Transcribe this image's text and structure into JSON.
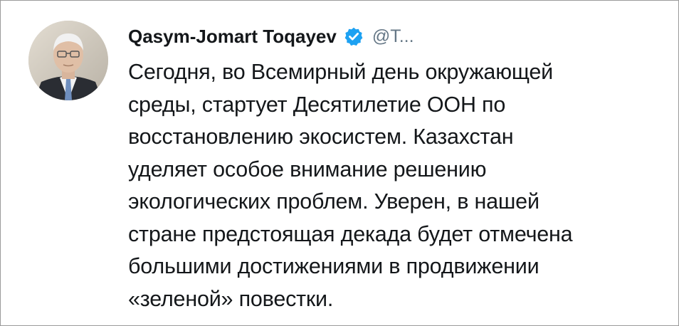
{
  "tweet": {
    "author_name": "Qasym-Jomart Toqayev",
    "handle": "@T...",
    "verified_icon": "verified-badge-icon",
    "text_lines": [
      "Сегодня, во Всемирный день окружающей",
      "среды, стартует Десятилетие ООН по",
      "восстановлению экосистем. Казахстан",
      "уделяет особое внимание решению",
      "экологических проблем. Уверен, в нашей",
      "стране предстоящая декада будет отмечена",
      "большими достижениями в продвижении",
      "«зеленой» повестки."
    ]
  },
  "colors": {
    "verified": "#1da1f2",
    "text": "#14171a",
    "handle": "#657786"
  }
}
